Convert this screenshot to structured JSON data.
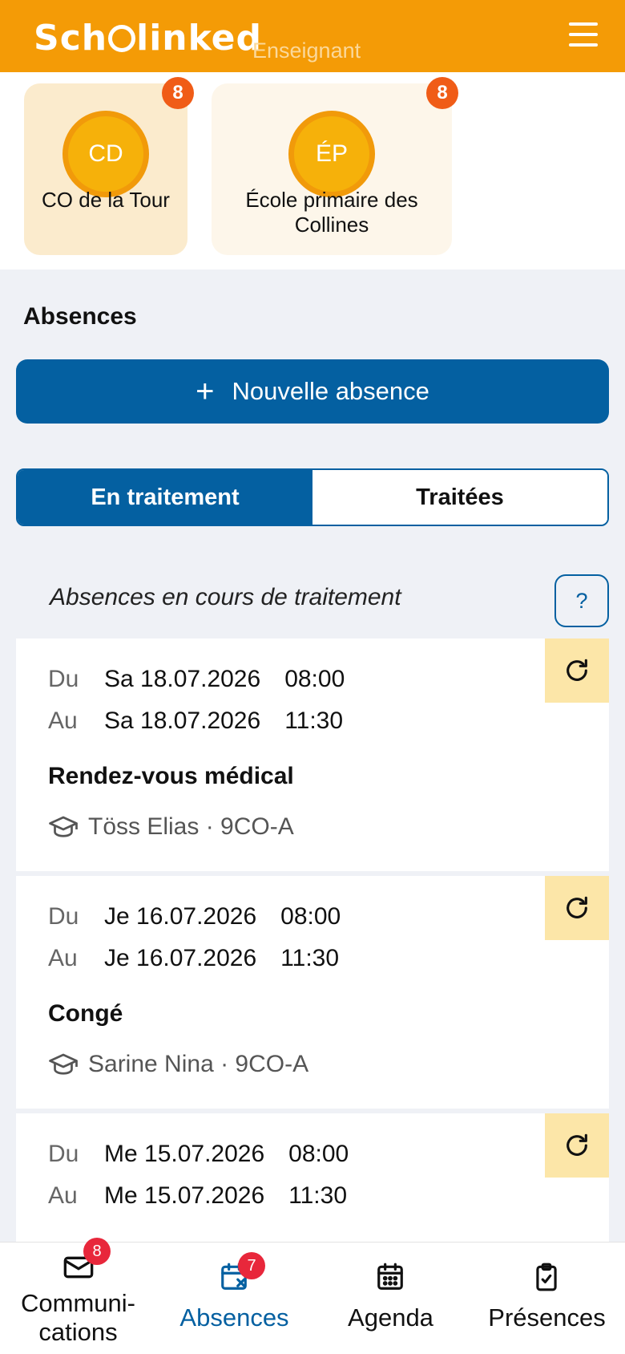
{
  "header": {
    "logo_text": "Schoolinked",
    "role": "Enseignant"
  },
  "schools": [
    {
      "initials": "CD",
      "name": "CO de la Tour",
      "badge": "8"
    },
    {
      "initials": "ÉP",
      "name": "École primaire des Collines",
      "badge": "8"
    }
  ],
  "absences": {
    "title": "Absences",
    "new_button": "Nouvelle absence",
    "tabs": [
      "En traitement",
      "Traitées"
    ],
    "list_title": "Absences en cours de traitement",
    "help_label": "?",
    "from_label": "Du",
    "to_label": "Au",
    "items": [
      {
        "from_date": "Sa 18.07.2026",
        "from_time": "08:00",
        "to_date": "Sa 18.07.2026",
        "to_time": "11:30",
        "reason": "Rendez-vous médical",
        "student": "Töss Elias · 9CO-A"
      },
      {
        "from_date": "Je 16.07.2026",
        "from_time": "08:00",
        "to_date": "Je 16.07.2026",
        "to_time": "11:30",
        "reason": "Congé",
        "student": "Sarine Nina · 9CO-A"
      },
      {
        "from_date": "Me 15.07.2026",
        "from_time": "08:00",
        "to_date": "Me 15.07.2026",
        "to_time": "11:30"
      }
    ]
  },
  "bottom_nav": [
    {
      "label_line1": "Communi-",
      "label_line2": "cations",
      "badge": "8"
    },
    {
      "label": "Absences",
      "badge": "7"
    },
    {
      "label": "Agenda"
    },
    {
      "label": "Présences"
    }
  ],
  "colors": {
    "brand_orange": "#f49b06",
    "primary_blue": "#0460a1",
    "badge_red": "#e8273b",
    "badge_orange": "#f05c17"
  }
}
